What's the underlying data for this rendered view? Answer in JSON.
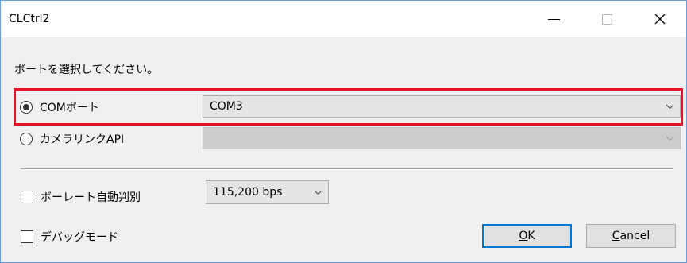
{
  "window": {
    "title": "CLCtrl2",
    "minimize_glyph": "—",
    "close_glyph": "✕"
  },
  "prompt": "ポートを選択してください。",
  "port_options": {
    "com": {
      "label": "COMポート",
      "selected": true,
      "combo_value": "COM3"
    },
    "camera_link": {
      "label": "カメラリンクAPI",
      "selected": false,
      "combo_value": ""
    }
  },
  "baud": {
    "auto_label": "ボーレート自動判別",
    "auto_checked": false,
    "rate_value": "115,200 bps"
  },
  "debug": {
    "label": "デバッグモード",
    "checked": false
  },
  "buttons": {
    "ok": {
      "mnemonic": "O",
      "rest": "K"
    },
    "cancel": {
      "mnemonic": "C",
      "rest": "ancel"
    }
  },
  "colors": {
    "highlight": "#e81123",
    "default_button_border": "#0078d7"
  },
  "icons": {
    "combo_arrow": "chevron-down-icon",
    "radio_selected": "radio-selected-icon"
  }
}
